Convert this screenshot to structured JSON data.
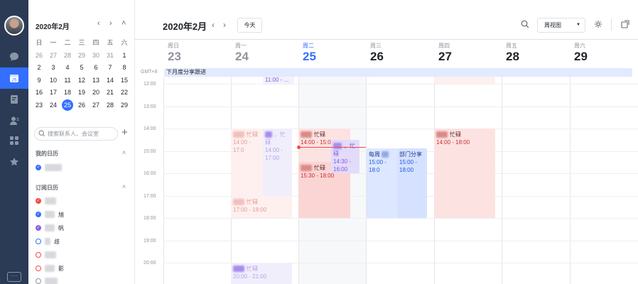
{
  "mini_calendar": {
    "month_label": "2020年2月",
    "nav_prev": "‹",
    "nav_next": "›",
    "collapse": "˄",
    "weekdays": [
      "日",
      "一",
      "二",
      "三",
      "四",
      "五",
      "六"
    ],
    "weeks": [
      [
        "26",
        "27",
        "28",
        "29",
        "30",
        "31",
        "1"
      ],
      [
        "2",
        "3",
        "4",
        "5",
        "6",
        "7",
        "8"
      ],
      [
        "9",
        "10",
        "11",
        "12",
        "13",
        "14",
        "15"
      ],
      [
        "16",
        "17",
        "18",
        "19",
        "20",
        "21",
        "22"
      ],
      [
        "23",
        "24",
        "25",
        "26",
        "27",
        "28",
        "29"
      ]
    ],
    "today": "25"
  },
  "sidebar": {
    "search_placeholder": "搜索联系人、会议室",
    "add_label": "+",
    "my_calendars_title": "我的日历",
    "subscribed_title": "订阅日历",
    "caret": "˄",
    "my_calendar_colors": [
      "#3370ff"
    ],
    "subscribed_items": [
      {
        "color": "#f54a45",
        "style": "filled",
        "label_suffix": ""
      },
      {
        "color": "#3370ff",
        "style": "filled",
        "label_suffix": "旭"
      },
      {
        "color": "#8f5fe8",
        "style": "filled",
        "label_suffix": "帆"
      },
      {
        "color": "#3370ff",
        "style": "ring",
        "label_suffix": "歧"
      },
      {
        "color": "#f54a45",
        "style": "ring",
        "label_suffix": ""
      },
      {
        "color": "#f54a45",
        "style": "ring",
        "label_suffix": "影"
      },
      {
        "color": "#8f959e",
        "style": "ring",
        "label_suffix": ""
      }
    ]
  },
  "toolbar": {
    "title": "2020年2月",
    "prev": "‹",
    "next": "›",
    "today_label": "今天",
    "view_label": "周视图",
    "view_caret": "▼"
  },
  "week": {
    "timezone": "GMT+8",
    "days": [
      {
        "name": "周日",
        "date": "23",
        "state": "muted"
      },
      {
        "name": "周一",
        "date": "24",
        "state": "muted"
      },
      {
        "name": "周二",
        "date": "25",
        "state": "today"
      },
      {
        "name": "周三",
        "date": "26",
        "state": "normal"
      },
      {
        "name": "周四",
        "date": "27",
        "state": "normal"
      },
      {
        "name": "周五",
        "date": "28",
        "state": "normal"
      },
      {
        "name": "周六",
        "date": "29",
        "state": "normal"
      }
    ],
    "all_day_event": "下月度分享跟进",
    "hours": [
      "12:00",
      "13:00",
      "14:00",
      "15:00",
      "16:00",
      "17:00",
      "18:00",
      "19:00",
      "20:00"
    ]
  },
  "events": {
    "mon_1": {
      "title": "忙碌",
      "time": "14:00 - 17:0"
    },
    "mon_2": {
      "title": "，忙",
      "sub": "碌",
      "time": "14:00 -\n17:00"
    },
    "mon_3": {
      "title": "忙碌",
      "time": "17:00 - 18:00"
    },
    "mon_4": {
      "title": "忙碌",
      "time": "20:00 - 21:00"
    },
    "tue_top": {
      "time": "11:00 - ..."
    },
    "tue_1": {
      "title": "忙碌",
      "time": "14:00 - 15:0"
    },
    "tue_2": {
      "title": "，忙",
      "sub": "碌",
      "time": "14:30 -\n16:00"
    },
    "tue_3": {
      "title": "忙碌",
      "time": "15:30 - 18:00"
    },
    "wed_1": {
      "title": "每周",
      "time": "15:00 - 18:0"
    },
    "wed_2": {
      "title": "部门分享",
      "time": "15:00 -\n18:00"
    },
    "thu_1": {
      "title": "忙碌",
      "time": "14:00 - 18:00"
    }
  }
}
